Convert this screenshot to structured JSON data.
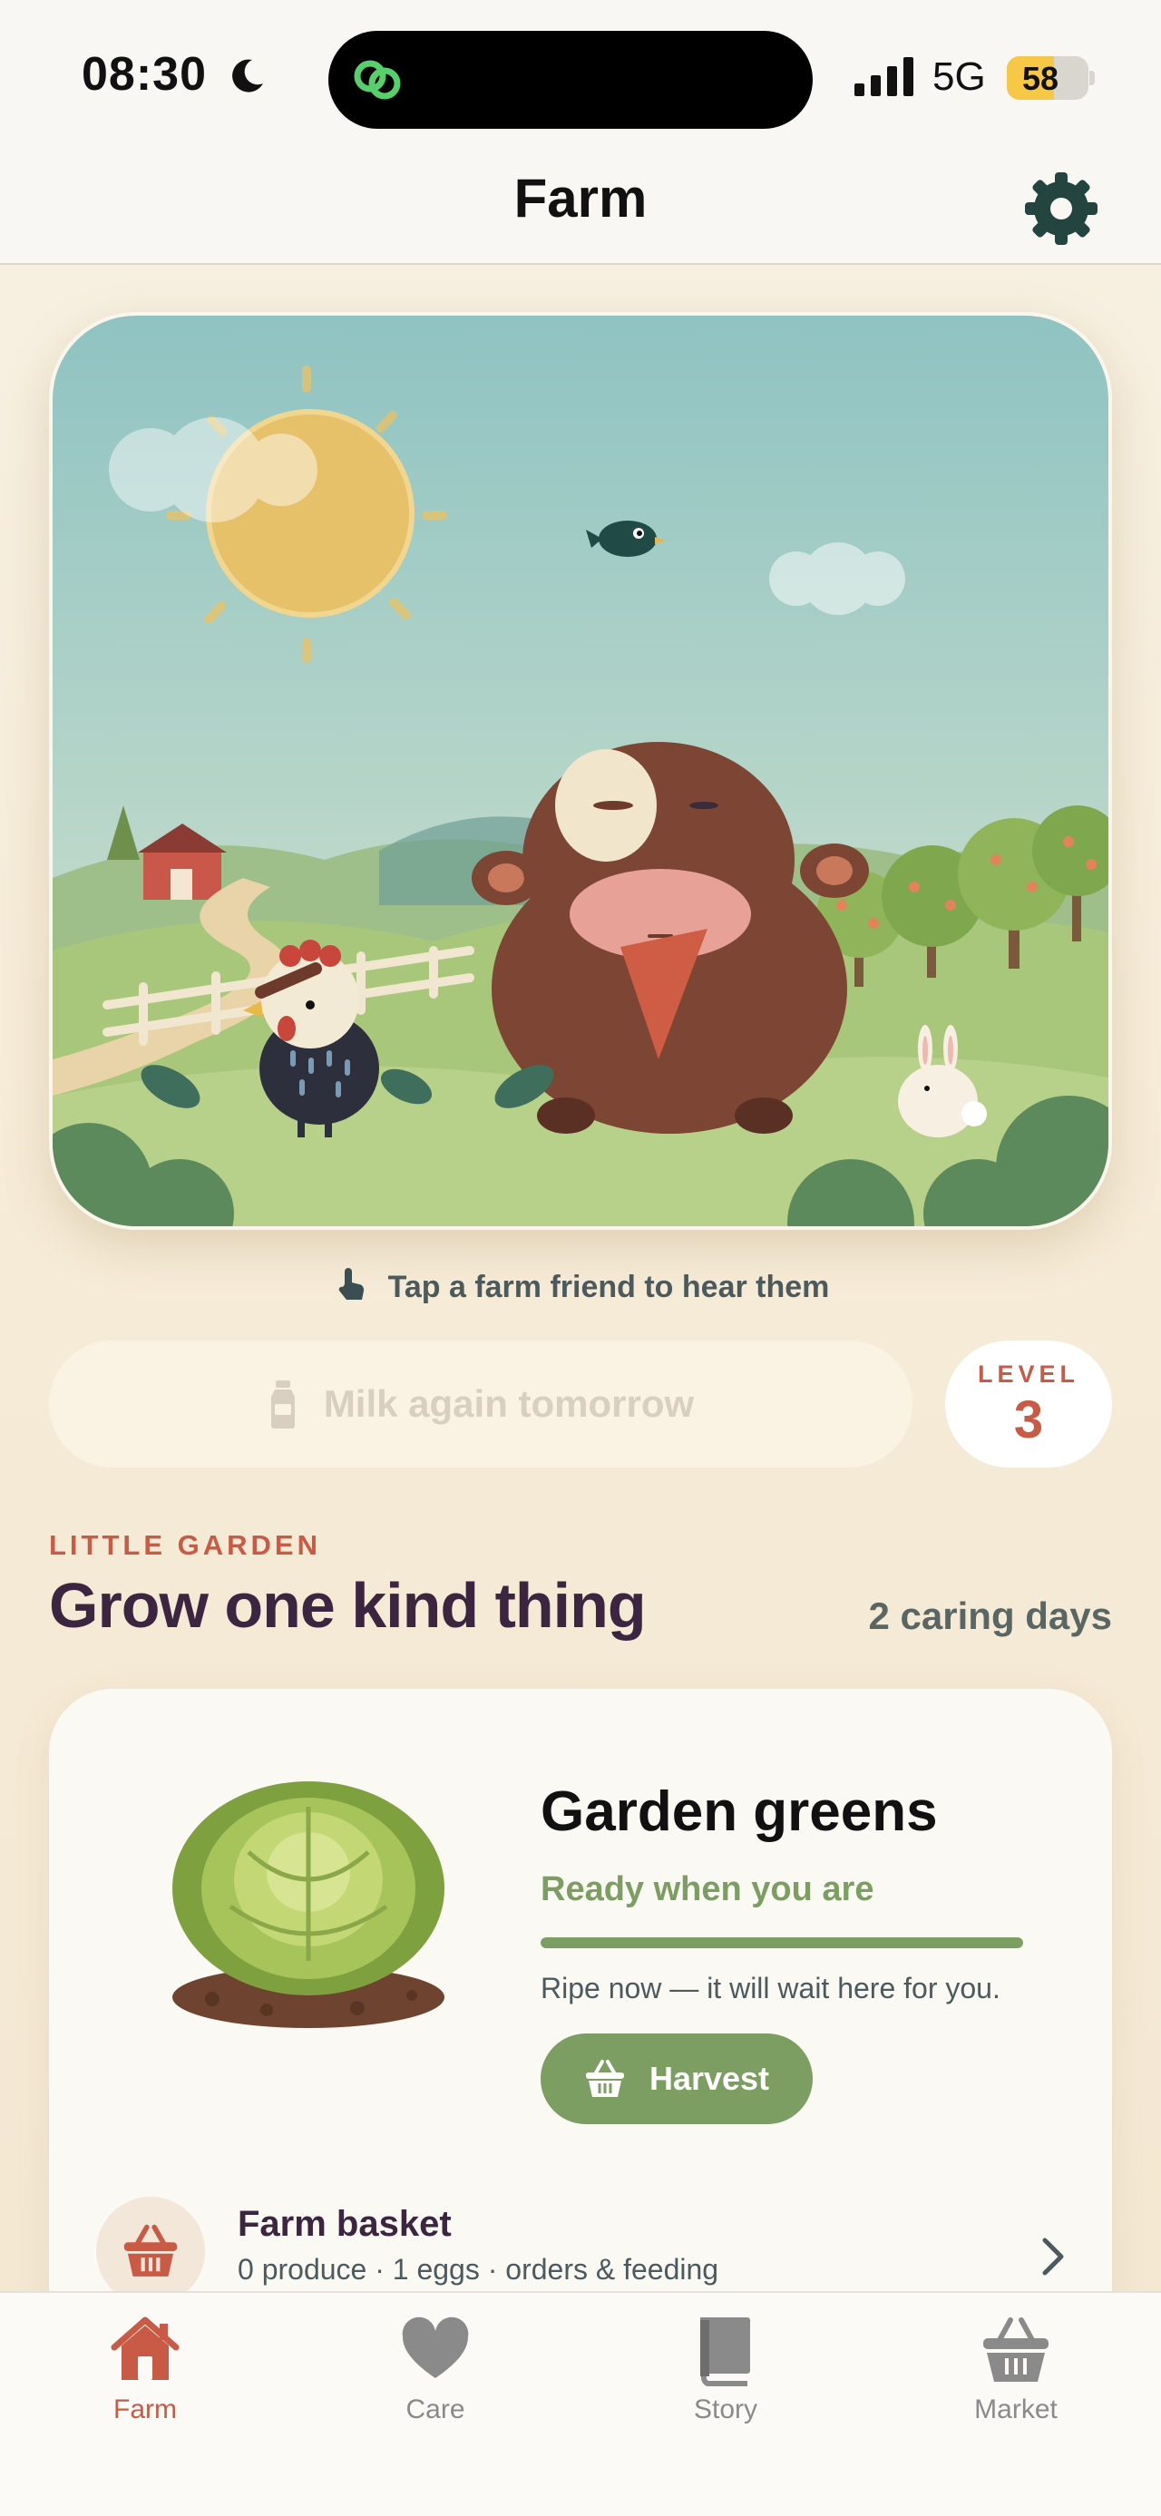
{
  "status_bar": {
    "time": "08:30",
    "network": "5G",
    "battery_level": 58,
    "battery_text": "58"
  },
  "nav": {
    "title": "Farm",
    "settings_icon": "gear-icon"
  },
  "scene": {
    "hint": "Tap a farm friend to hear them",
    "animals": [
      "cow",
      "chicken",
      "bird",
      "bunny"
    ]
  },
  "actions": {
    "milk_label": "Milk again tomorrow",
    "milk_disabled": true,
    "level_label": "LEVEL",
    "level_value": "3"
  },
  "garden": {
    "eyebrow": "LITTLE GARDEN",
    "title": "Grow one kind thing",
    "caring_days": "2 caring days",
    "crop_name": "Garden greens",
    "crop_status": "Ready when you are",
    "growth_progress": 1.0,
    "crop_note": "Ripe now — it will wait here for you.",
    "harvest_label": "Harvest"
  },
  "basket": {
    "title": "Farm basket",
    "subtitle": "0 produce · 1 eggs · orders & feeding"
  },
  "tabs": [
    {
      "label": "Farm",
      "icon": "house-icon",
      "active": true
    },
    {
      "label": "Care",
      "icon": "heart-icon",
      "active": false
    },
    {
      "label": "Story",
      "icon": "book-icon",
      "active": false
    },
    {
      "label": "Market",
      "icon": "basket-icon",
      "active": false
    }
  ],
  "colors": {
    "accent": "#c95a45",
    "green": "#7d9e62",
    "heading": "#3b2540",
    "gear": "#24453f"
  }
}
